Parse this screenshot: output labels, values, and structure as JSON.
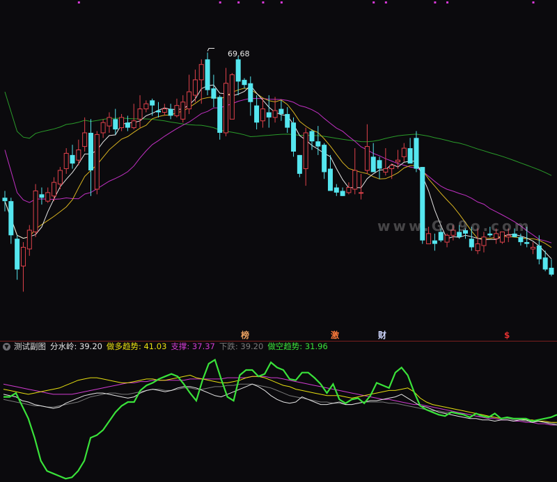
{
  "chart_data": [
    {
      "type": "candlestick",
      "annotations": [
        {
          "text": "69.68",
          "label": "period high"
        }
      ],
      "watermark": "www.Go9o.com",
      "colors": {
        "up": "#e0424b",
        "down": "#55e6ef",
        "ma_white": "#e8e8e8",
        "ma_yellow": "#d8b320",
        "ma_magenta": "#c130c3",
        "ma_green": "#2a9c2a"
      },
      "ohlc": [
        [
          61.2,
          61.6,
          60.4,
          61.0
        ],
        [
          61.0,
          61.2,
          58.5,
          59.0
        ],
        [
          58.8,
          59.0,
          56.4,
          57.0
        ],
        [
          57.2,
          58.6,
          55.7,
          58.3
        ],
        [
          58.2,
          59.6,
          57.8,
          59.3
        ],
        [
          59.2,
          62.0,
          58.9,
          61.6
        ],
        [
          61.4,
          61.8,
          60.8,
          61.2
        ],
        [
          61.0,
          61.8,
          60.9,
          61.5
        ],
        [
          61.3,
          62.4,
          61.0,
          62.1
        ],
        [
          62.0,
          63.0,
          61.7,
          62.8
        ],
        [
          62.9,
          64.1,
          62.6,
          63.8
        ],
        [
          63.7,
          64.3,
          62.9,
          63.2
        ],
        [
          63.4,
          64.6,
          63.1,
          64.0
        ],
        [
          64.2,
          65.9,
          63.9,
          65.0
        ],
        [
          65.0,
          65.8,
          61.3,
          62.8
        ],
        [
          61.7,
          65.1,
          61.4,
          64.9
        ],
        [
          65.0,
          65.8,
          64.7,
          65.6
        ],
        [
          65.4,
          66.2,
          65.0,
          65.9
        ],
        [
          65.8,
          66.4,
          64.9,
          65.2
        ],
        [
          65.3,
          66.1,
          65.1,
          65.9
        ],
        [
          65.6,
          66.0,
          65.1,
          65.3
        ],
        [
          65.3,
          66.7,
          65.2,
          65.7
        ],
        [
          65.8,
          67.2,
          65.3,
          66.4
        ],
        [
          66.4,
          66.9,
          66.2,
          66.7
        ],
        [
          66.9,
          67.0,
          66.0,
          66.6
        ],
        [
          66.3,
          66.8,
          65.9,
          66.2
        ],
        [
          66.2,
          66.7,
          66.0,
          66.4
        ],
        [
          66.4,
          66.7,
          65.8,
          66.0
        ],
        [
          66.0,
          67.0,
          65.9,
          66.6
        ],
        [
          65.8,
          67.2,
          65.6,
          66.8
        ],
        [
          66.4,
          68.4,
          66.1,
          67.4
        ],
        [
          67.2,
          68.7,
          66.8,
          68.1
        ],
        [
          68.1,
          69.3,
          66.7,
          69.0
        ],
        [
          69.3,
          69.7,
          67.2,
          67.5
        ],
        [
          67.6,
          68.4,
          66.5,
          67.0
        ],
        [
          67.1,
          67.2,
          64.6,
          65.0
        ],
        [
          65.0,
          68.8,
          64.8,
          67.9
        ],
        [
          65.8,
          68.5,
          65.8,
          68.4
        ],
        [
          69.3,
          69.5,
          67.2,
          68.0
        ],
        [
          68.1,
          68.2,
          67.6,
          67.8
        ],
        [
          67.9,
          68.3,
          66.0,
          66.8
        ],
        [
          66.6,
          67.2,
          65.2,
          65.6
        ],
        [
          65.7,
          67.0,
          65.3,
          66.4
        ],
        [
          66.2,
          67.2,
          65.3,
          65.9
        ],
        [
          65.9,
          67.1,
          65.6,
          66.3
        ],
        [
          66.4,
          66.9,
          65.7,
          66.1
        ],
        [
          66.1,
          66.5,
          65.0,
          65.3
        ],
        [
          65.6,
          65.9,
          63.6,
          63.9
        ],
        [
          63.7,
          63.7,
          62.4,
          62.6
        ],
        [
          62.9,
          65.3,
          61.9,
          65.0
        ],
        [
          65.1,
          65.2,
          64.0,
          64.5
        ],
        [
          64.5,
          65.4,
          63.7,
          64.2
        ],
        [
          64.3,
          64.4,
          62.3,
          62.7
        ],
        [
          62.9,
          63.7,
          61.6,
          61.6
        ],
        [
          61.8,
          62.0,
          61.3,
          61.5
        ],
        [
          61.6,
          61.8,
          61.3,
          61.3
        ],
        [
          61.5,
          62.1,
          61.4,
          61.8
        ],
        [
          61.7,
          64.1,
          61.4,
          62.8
        ],
        [
          61.5,
          62.6,
          61.1,
          61.5
        ],
        [
          62.8,
          65.5,
          62.6,
          64.2
        ],
        [
          63.6,
          64.4,
          62.8,
          62.7
        ],
        [
          63.4,
          63.6,
          62.3,
          62.9
        ],
        [
          62.7,
          64.1,
          62.5,
          62.9
        ],
        [
          62.9,
          63.2,
          62.3,
          63.1
        ],
        [
          63.3,
          64.0,
          62.9,
          63.4
        ],
        [
          63.6,
          64.4,
          63.3,
          64.1
        ],
        [
          64.1,
          64.7,
          63.4,
          63.2
        ],
        [
          64.7,
          65.1,
          62.7,
          62.9
        ],
        [
          63.0,
          63.0,
          58.5,
          58.7
        ],
        [
          58.5,
          59.5,
          58.5,
          59.1
        ],
        [
          58.7,
          59.1,
          58.1,
          58.5
        ],
        [
          59.2,
          59.4,
          58.6,
          58.7
        ],
        [
          58.6,
          59.1,
          58.3,
          59.0
        ],
        [
          59.0,
          59.6,
          58.7,
          59.3
        ],
        [
          59.2,
          59.6,
          58.8,
          58.9
        ],
        [
          59.3,
          59.4,
          58.8,
          59.1
        ],
        [
          58.8,
          59.5,
          58.1,
          58.3
        ],
        [
          58.1,
          59.4,
          57.9,
          58.5
        ],
        [
          58.4,
          59.2,
          58.0,
          58.9
        ],
        [
          59.1,
          59.5,
          58.9,
          59.0
        ],
        [
          58.8,
          59.4,
          58.5,
          59.1
        ],
        [
          58.6,
          59.2,
          58.5,
          59.2
        ],
        [
          58.9,
          59.4,
          58.6,
          59.0
        ],
        [
          59.1,
          59.4,
          58.9,
          58.9
        ],
        [
          58.9,
          59.1,
          58.4,
          58.6
        ],
        [
          58.6,
          59.5,
          58.3,
          58.5
        ],
        [
          58.2,
          58.6,
          57.9,
          58.3
        ],
        [
          58.4,
          59.0,
          57.3,
          57.6
        ],
        [
          57.7,
          58.1,
          56.9,
          57.0
        ],
        [
          57.1,
          57.6,
          56.6,
          56.7
        ]
      ]
    },
    {
      "type": "line",
      "series": [
        {
          "name": "分水岭",
          "color": "#e6e6e6",
          "values": [
            64,
            63,
            62,
            59,
            58,
            56,
            55,
            54,
            53,
            54,
            57,
            59,
            61,
            63,
            64,
            65,
            65,
            64,
            63,
            62,
            61,
            62,
            65,
            67,
            68,
            67,
            66,
            67,
            69,
            70,
            70,
            69,
            67,
            65,
            63,
            62,
            64,
            66,
            68,
            70,
            72,
            70,
            67,
            63,
            60,
            58,
            57,
            58,
            62,
            60,
            58,
            56,
            56,
            57,
            58,
            56,
            56,
            57,
            58,
            59,
            59,
            60,
            61,
            62,
            64,
            61,
            58,
            55,
            54,
            52,
            50,
            49,
            48,
            47,
            46,
            45,
            45,
            44,
            44,
            43,
            44,
            44,
            43,
            44,
            44,
            42,
            43,
            42,
            41,
            40
          ]
        },
        {
          "name": "做多趋势",
          "color": "#e8e010",
          "values": [
            68,
            67,
            66,
            65,
            64,
            65,
            66,
            67,
            68,
            69,
            71,
            73,
            75,
            76,
            77,
            77,
            76,
            75,
            74,
            73,
            73,
            74,
            75,
            76,
            76,
            75,
            75,
            76,
            77,
            78,
            79,
            77,
            76,
            75,
            74,
            73,
            73,
            74,
            75,
            77,
            78,
            78,
            77,
            75,
            73,
            71,
            70,
            68,
            67,
            66,
            65,
            64,
            63,
            63,
            63,
            62,
            61,
            62,
            63,
            64,
            65,
            66,
            67,
            67,
            68,
            69,
            66,
            61,
            58,
            56,
            55,
            54,
            53,
            52,
            51,
            50,
            49,
            48,
            47,
            46,
            45,
            46,
            45,
            45,
            44,
            44,
            43,
            43,
            42,
            42
          ]
        },
        {
          "name": "支撑",
          "color": "#d23cd2",
          "values": [
            72,
            71,
            70,
            69,
            68,
            67,
            66,
            65,
            64,
            64,
            64,
            64,
            65,
            66,
            67,
            68,
            69,
            70,
            71,
            72,
            73,
            73,
            74,
            74,
            75,
            75,
            75,
            75,
            75,
            75,
            76,
            76,
            76,
            76,
            76,
            76,
            77,
            77,
            77,
            77,
            78,
            78,
            78,
            77,
            77,
            76,
            75,
            74,
            73,
            72,
            71,
            70,
            69,
            68,
            67,
            66,
            65,
            64,
            63,
            62,
            61,
            60,
            60,
            59,
            58,
            57,
            56,
            56,
            55,
            54,
            53,
            52,
            51,
            50,
            49,
            48,
            47,
            46,
            45,
            45,
            44,
            44,
            43,
            43,
            42,
            42,
            41,
            41,
            40,
            40
          ]
        },
        {
          "name": "下跌",
          "color": "#7a7a7a",
          "values": [
            60,
            59,
            58,
            57,
            56,
            55,
            55,
            54,
            54,
            55,
            56,
            57,
            58,
            60,
            62,
            63,
            64,
            65,
            65,
            64,
            64,
            65,
            66,
            67,
            68,
            68,
            67,
            67,
            68,
            69,
            69,
            68,
            68,
            69,
            70,
            70,
            71,
            71,
            72,
            72,
            72,
            71,
            70,
            69,
            67,
            65,
            63,
            62,
            61,
            60,
            59,
            58,
            58,
            57,
            57,
            56,
            56,
            57,
            58,
            58,
            58,
            58,
            57,
            57,
            56,
            55,
            54,
            53,
            52,
            51,
            51,
            50,
            50,
            49,
            49,
            48,
            47,
            47,
            46,
            46,
            45,
            45,
            44,
            44,
            43,
            43,
            43,
            42,
            42,
            41
          ]
        },
        {
          "name": "做空趋势",
          "color": "#3ae33a",
          "values": [
            62,
            62,
            65,
            55,
            45,
            30,
            12,
            4,
            2,
            0,
            -2,
            -1,
            4,
            12,
            30,
            32,
            36,
            43,
            50,
            55,
            58,
            58,
            67,
            71,
            73,
            76,
            78,
            80,
            78,
            72,
            65,
            59,
            75,
            88,
            91,
            76,
            62,
            59,
            79,
            83,
            83,
            78,
            80,
            89,
            85,
            83,
            76,
            75,
            81,
            81,
            77,
            72,
            65,
            72,
            60,
            57,
            60,
            61,
            57,
            63,
            73,
            71,
            69,
            81,
            85,
            79,
            66,
            55,
            52,
            50,
            48,
            47,
            50,
            49,
            48,
            46,
            49,
            47,
            46,
            49,
            45,
            46,
            45,
            45,
            45,
            43,
            44,
            45,
            46,
            48
          ]
        }
      ]
    }
  ],
  "sub_panel": {
    "collapse_icon": "chevron-down-icon",
    "title": "测试副图",
    "legend": [
      {
        "label": "分水岭: 39.20",
        "color": "#e6e6e6"
      },
      {
        "label": "做多趋势: 41.03",
        "color": "#e8e010"
      },
      {
        "label": "支撑: 37.37",
        "color": "#d23cd2"
      },
      {
        "label": "下跌: 39.20",
        "color": "#7a7a7a"
      },
      {
        "label": "做空趋势: 31.96",
        "color": "#3ae33a"
      }
    ]
  },
  "event_tags": [
    {
      "text": "榜",
      "color": "#e8a060"
    },
    {
      "text": "激",
      "color": "#ff7a3a"
    },
    {
      "text": "财",
      "color": "#cfd7ff"
    },
    {
      "text": "$",
      "color": "#e03030"
    }
  ],
  "top_marker_color": "#d838d8"
}
